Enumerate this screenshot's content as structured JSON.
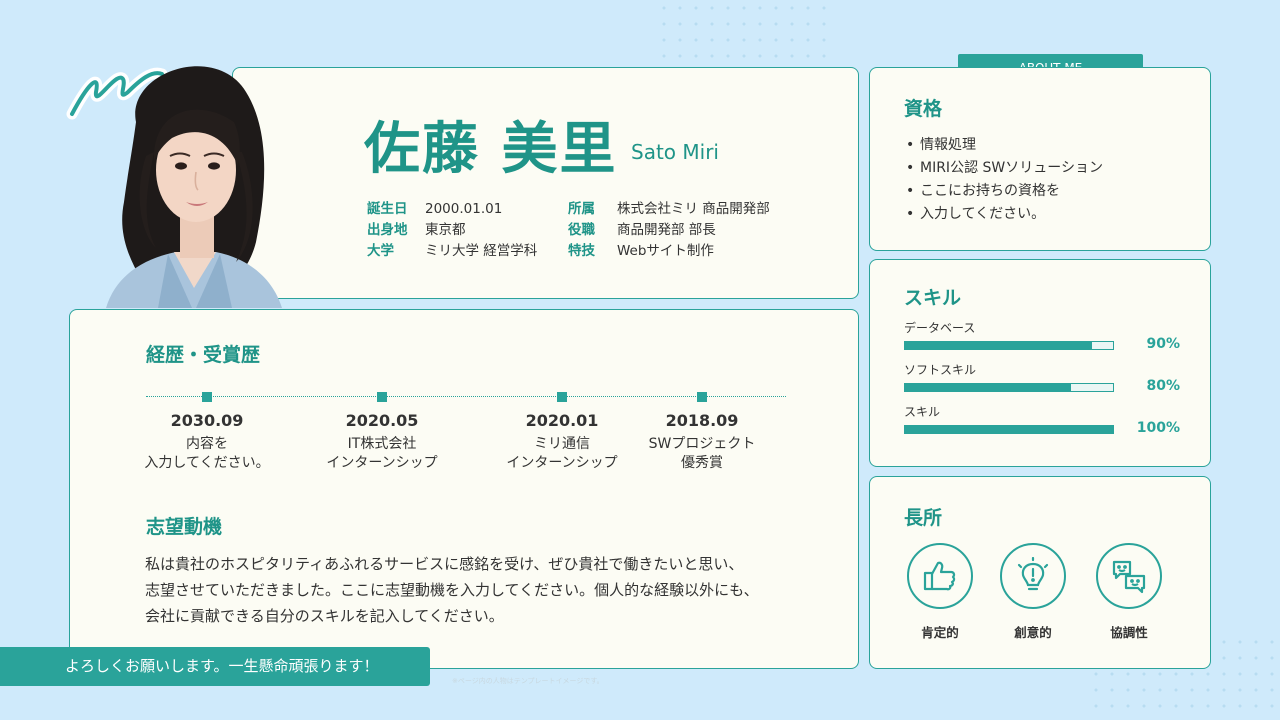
{
  "profile": {
    "name_jp": "佐藤 美里",
    "name_en": "Sato Miri",
    "details_left": [
      {
        "label": "誕生日",
        "value": "2000.01.01"
      },
      {
        "label": "出身地",
        "value": "東京都"
      },
      {
        "label": "大学",
        "value": "ミリ大学 経営学科"
      }
    ],
    "details_right": [
      {
        "label": "所属",
        "value": "株式会社ミリ 商品開発部"
      },
      {
        "label": "役職",
        "value": "商品開発部 部長"
      },
      {
        "label": "特技",
        "value": "Webサイト制作"
      }
    ]
  },
  "about_tab": "ABOUT ME",
  "qualifications": {
    "title": "資格",
    "items": [
      "情報処理",
      "MIRI公認 SWソリューション",
      "ここにお持ちの資格を",
      "入力してください。"
    ]
  },
  "skills": {
    "title": "スキル",
    "items": [
      {
        "name": "データベース",
        "percent_label": "90%",
        "level": 0.9
      },
      {
        "name": "ソフトスキル",
        "percent_label": "80%",
        "level": 0.8
      },
      {
        "name": "スキル",
        "percent_label": "100%",
        "level": 1.0
      }
    ]
  },
  "strengths": {
    "title": "長所",
    "items": [
      {
        "label": "肯定的",
        "icon": "thumbs-up-icon"
      },
      {
        "label": "創意的",
        "icon": "lightbulb-icon"
      },
      {
        "label": "協調性",
        "icon": "chat-bubbles-icon"
      }
    ]
  },
  "career": {
    "title": "経歴・受賞歴",
    "timeline": [
      {
        "date": "2030.09",
        "line1": "内容を",
        "line2": "入力してください。"
      },
      {
        "date": "2020.05",
        "line1": "IT株式会社",
        "line2": "インターンシップ"
      },
      {
        "date": "2020.01",
        "line1": "ミリ通信",
        "line2": "インターンシップ"
      },
      {
        "date": "2018.09",
        "line1": "SWプロジェクト",
        "line2": "優秀賞"
      }
    ]
  },
  "motivation": {
    "title": "志望動機",
    "lines": [
      "私は貴社のホスピタリティあふれるサービスに感銘を受け、ぜひ貴社で働きたいと思い、",
      "志望させていただきました。ここに志望動機を入力してください。個人的な経験以外にも、",
      "会社に貢献できる自分のスキルを記入してください。"
    ]
  },
  "footer": "よろしくお願いします。一生懸命頑張ります！",
  "footnote": "※ページ内の人物はテンプレートイメージです。",
  "colors": {
    "accent": "#2aa39a",
    "background": "#cfeafb",
    "card": "#fcfcf4"
  }
}
